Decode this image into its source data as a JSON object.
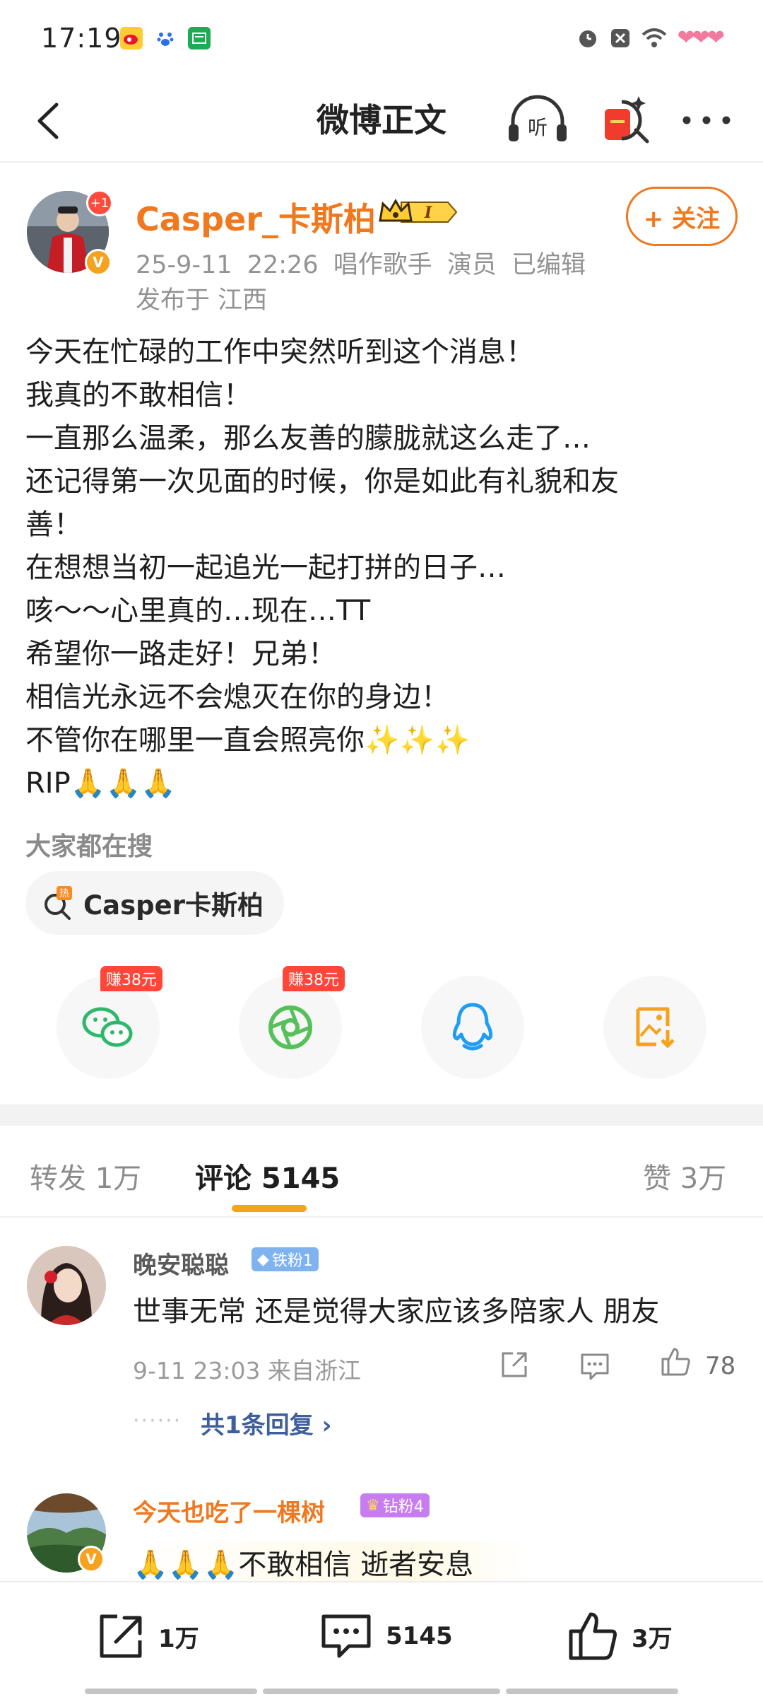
{
  "status_bar": {
    "time": "17:19"
  },
  "nav": {
    "title": "微博正文",
    "listen_label": "听"
  },
  "author": {
    "name": "Casper_卡斯柏",
    "plus_badge": "+1",
    "verified_mark": "V",
    "level_badge": "I",
    "meta": "25-9-11 22:26  唱作歌手 演员  已编辑",
    "location": "发布于 江西",
    "follow_label": "+ 关注"
  },
  "post": {
    "lines": [
      "今天在忙碌的工作中突然听到这个消息！",
      "我真的不敢相信！",
      "一直那么温柔，那么友善的朦胧就这么走了…",
      "还记得第一次见面的时候，你是如此有礼貌和友",
      "善！",
      "在想想当初一起追光一起打拼的日子…",
      "咳～～心里真的…现在…TT",
      "希望你一路走好！兄弟！",
      "相信光永远不会熄灭在你的身边！",
      "不管你在哪里一直会照亮你✨✨✨",
      "RIP🙏🙏🙏"
    ]
  },
  "search": {
    "title": "大家都在搜",
    "chip_label": "Casper卡斯柏",
    "hot_mark": "热"
  },
  "share": {
    "bonus_label": "赚38元",
    "items": [
      "wechat-icon",
      "moments-icon",
      "qq-icon",
      "save-image-icon"
    ]
  },
  "tabs": {
    "repost": "转发 1万",
    "comments": "评论 5145",
    "likes": "赞 3万"
  },
  "comments": [
    {
      "user": "晚安聪聪",
      "badge": "铁粉1",
      "text": "世事无常 还是觉得大家应该多陪家人 朋友",
      "meta": "9-11 23:03  来自浙江",
      "likes": "78",
      "replies": "共1条回复 ›"
    },
    {
      "user": "今天也吃了一棵树",
      "badge": "钻粉4",
      "text": "🙏🙏🙏不敢相信 逝者安息"
    }
  ],
  "bottom_bar": {
    "repost_count": "1万",
    "comment_count": "5145",
    "like_count": "3万"
  },
  "colors": {
    "accent_orange": "#f0781e",
    "brand_gold": "#f6a21e",
    "reply_blue": "#3e5e9c"
  }
}
